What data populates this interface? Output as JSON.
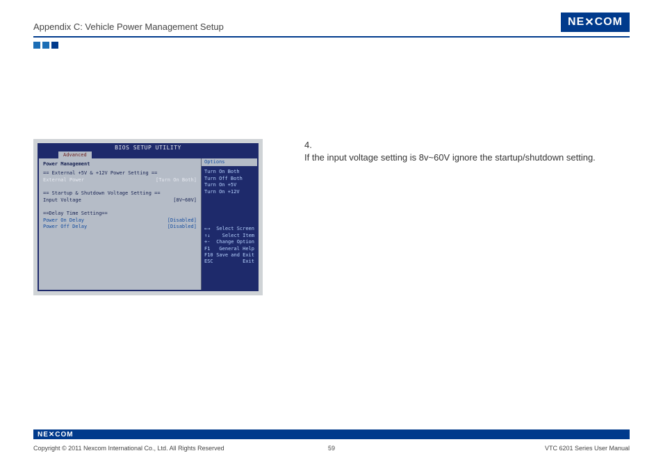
{
  "header": {
    "title": "Appendix C: Vehicle Power Management Setup",
    "logo": "NEXCOM"
  },
  "bios": {
    "title": "BIOS SETUP UTILITY",
    "tab": "Advanced",
    "left": {
      "section_title": "Power Management",
      "group1_header": "== External +5V & +12V Power Setting ==",
      "group1_label": "External Power",
      "group1_value": "[Turn On Both]",
      "group2_header": "== Startup & Shutdown Voltage Setting ==",
      "group2_label": "Input Voltage",
      "group2_value": "[8V~60V]",
      "group3_header": "==Delay Time Setting==",
      "group3a_label": "Power On Delay",
      "group3a_value": "[Disabled]",
      "group3b_label": "Power Off Delay",
      "group3b_value": "[Disabled]"
    },
    "right": {
      "options_header": "Options",
      "opt1": "Turn On Both",
      "opt2": "Turn Off Both",
      "opt3": "Turn On +5V",
      "opt4": "Turn On +12V",
      "help1_key": "←→",
      "help1": "Select Screen",
      "help2_key": "↑↓",
      "help2": "Select Item",
      "help3_key": "+-",
      "help3": "Change Option",
      "help4_key": "F1",
      "help4": "General Help",
      "help5_key": "F10",
      "help5": "Save and Exit",
      "help6_key": "ESC",
      "help6": "Exit"
    }
  },
  "step": {
    "number": "4.",
    "text": "If the input voltage setting is 8v~60V ignore the startup/shutdown setting."
  },
  "footer": {
    "logo": "NEXCOM",
    "copyright": "Copyright © 2011 Nexcom International Co., Ltd. All Rights Reserved",
    "page": "59",
    "manual": "VTC 6201 Series User Manual"
  }
}
